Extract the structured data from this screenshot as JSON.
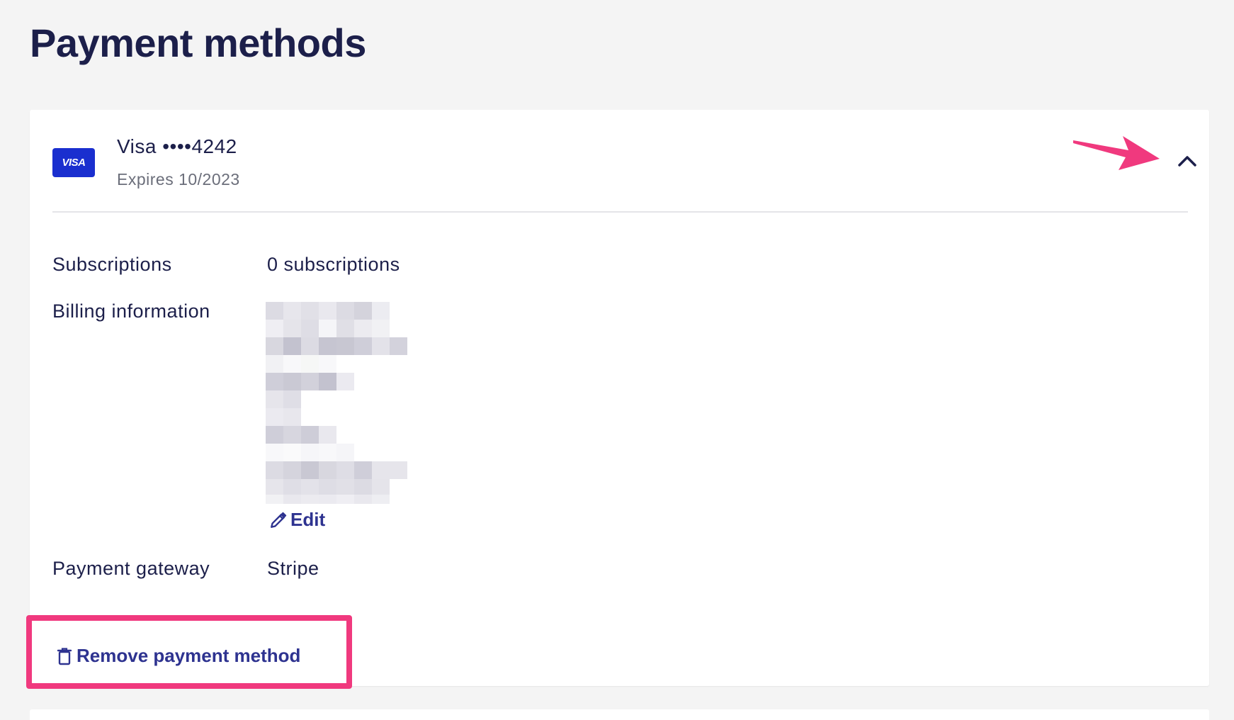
{
  "page": {
    "title": "Payment methods"
  },
  "payment_method": {
    "brand_badge": "VISA",
    "name": "Visa ••••4242",
    "expiry": "Expires 10/2023",
    "rows": {
      "subscriptions_label": "Subscriptions",
      "subscriptions_value": "0 subscriptions",
      "billing_label": "Billing information",
      "gateway_label": "Payment gateway",
      "gateway_value": "Stripe"
    },
    "edit_label": "Edit",
    "remove_label": "Remove payment method"
  },
  "icons": {
    "collapse": "chevron-up-icon",
    "edit": "pencil-icon",
    "remove": "trash-icon"
  },
  "colors": {
    "brand_blue": "#1a2fcf",
    "link": "#2e3390",
    "text": "#1c1f4a",
    "annotation": "#f0397e"
  }
}
